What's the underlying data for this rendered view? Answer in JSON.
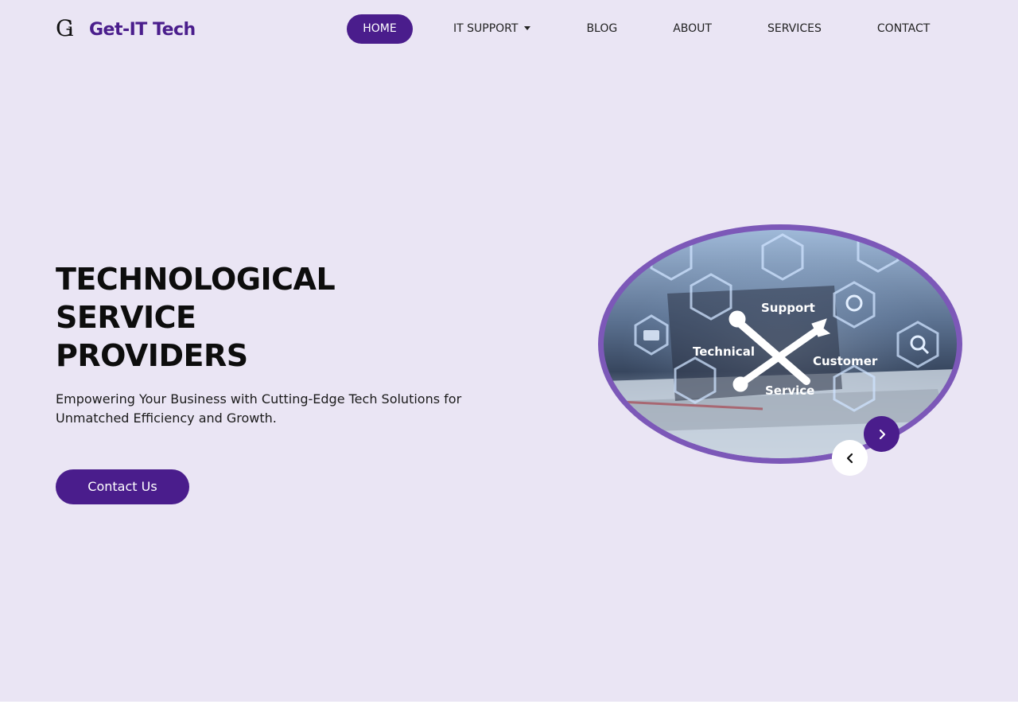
{
  "logo": {
    "mark_big": "G",
    "mark_small": "i",
    "name": "Get-IT Tech"
  },
  "nav": {
    "items": [
      {
        "label": "HOME",
        "active": true
      },
      {
        "label": "IT SUPPORT",
        "dropdown": true
      },
      {
        "label": "BLOG"
      },
      {
        "label": "ABOUT"
      },
      {
        "label": "SERVICES"
      },
      {
        "label": "CONTACT"
      }
    ]
  },
  "hero": {
    "title_lines": [
      "TECHNOLOGICAL",
      "SERVICE",
      "PROVIDERS"
    ],
    "subtitle": "Empowering Your Business with Cutting-Edge Tech Solutions for Unmatched Efficiency and Growth.",
    "cta_label": "Contact Us"
  },
  "carousel": {
    "image_labels": {
      "support": "Support",
      "technical": "Technical",
      "customer": "Customer",
      "service": "Service"
    },
    "prev_icon": "chevron-left-icon",
    "next_icon": "chevron-right-icon"
  },
  "colors": {
    "brand": "#4a1d8c",
    "hero_bg": "#eae5f4",
    "frame": "#7c58b8"
  }
}
